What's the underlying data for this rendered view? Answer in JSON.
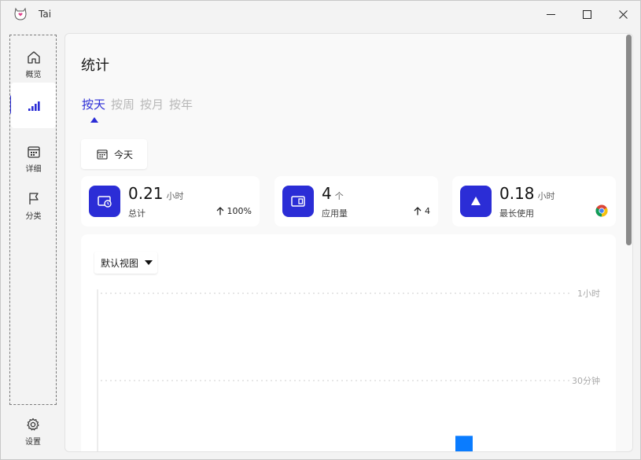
{
  "window": {
    "title": "Tai"
  },
  "sidebar": {
    "items": [
      {
        "label": "概览",
        "icon": "home-icon"
      },
      {
        "label": "",
        "icon": "bar-chart-icon"
      },
      {
        "label": "详细",
        "icon": "calendar-icon"
      },
      {
        "label": "分类",
        "icon": "flag-icon"
      }
    ],
    "settings_label": "设置"
  },
  "page": {
    "title": "统计",
    "tabs": [
      "按天",
      "按周",
      "按月",
      "按年"
    ],
    "active_tab": "按天",
    "date_button": "今天"
  },
  "cards": [
    {
      "value": "0.21",
      "unit": "小时",
      "label": "总计",
      "trend": "100%",
      "icon": "clock-screen-icon"
    },
    {
      "value": "4",
      "unit": "个",
      "label": "应用量",
      "trend": "4",
      "icon": "app-window-icon"
    },
    {
      "value": "0.18",
      "unit": "小时",
      "label": "最长使用",
      "icon": "triangle-icon",
      "app_icon": "chrome-icon"
    }
  ],
  "chart": {
    "view_select": "默认视图"
  },
  "chart_data": {
    "type": "bar",
    "y_ticks": [
      "1小时",
      "30分钟"
    ],
    "ylim_minutes": [
      0,
      60
    ],
    "bars": [
      {
        "value_minutes": 11
      }
    ],
    "grid": true,
    "bar_color": "#0a7cff"
  },
  "colors": {
    "accent": "#2b2dd6",
    "bar": "#0a7cff"
  }
}
